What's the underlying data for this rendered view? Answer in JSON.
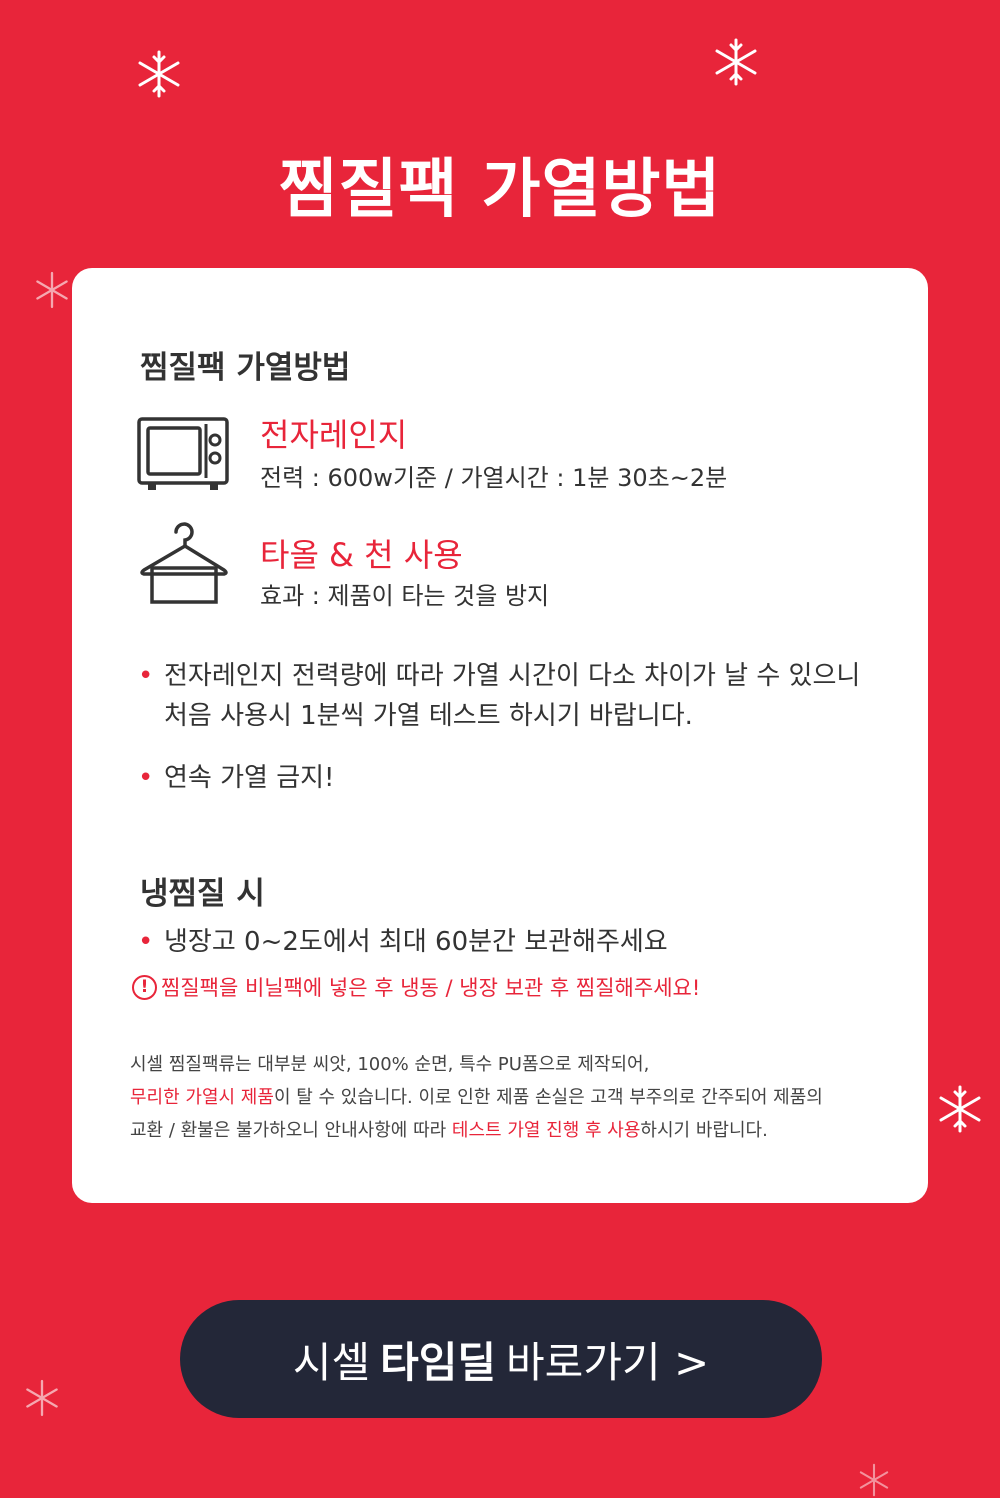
{
  "header": {
    "title": "찜질팩 가열방법"
  },
  "card": {
    "section_heat": {
      "title": "찜질팩 가열방법",
      "methods": [
        {
          "icon": "microwave-icon",
          "title": "전자레인지",
          "desc": "전력 : 600w기준 / 가열시간 : 1분 30초~2분"
        },
        {
          "icon": "towel-hanger-icon",
          "title": "타올 & 천 사용",
          "desc": "효과 : 제품이 타는 것을 방지"
        }
      ],
      "bullets": [
        {
          "line1": "전자레인지 전력량에 따라 가열 시간이 다소 차이가 날 수 있으니",
          "line2": "처음 사용시 1분씩 가열 테스트 하시기 바랍니다."
        },
        {
          "line1": "연속 가열 금지!"
        }
      ]
    },
    "section_cold": {
      "title": "냉찜질 시",
      "bullet": "냉장고 0~2도에서 최대 60분간 보관해주세요",
      "warning": "찜질팩을 비닐팩에 넣은 후 냉동 / 냉장 보관 후 찜질해주세요!"
    },
    "notice": {
      "line1": "시셀 찜질팩류는 대부분 씨앗, 100% 순면, 특수 PU폼으로 제작되어,",
      "line2_hl": "무리한 가열시 제품",
      "line2_rest": "이 탈 수 있습니다. 이로 인한 제품 손실은 고객 부주의로 간주되어  제품의",
      "line3_pre": "교환 / 환불은 불가하오니 안내사항에 따라 ",
      "line3_hl": "테스트 가열 진행 후 사용",
      "line3_post": "하시기 바랍니다."
    }
  },
  "cta": {
    "pre": "시셀",
    "bold": "타임딜",
    "post": "바로가기 >"
  },
  "colors": {
    "background": "#e8253a",
    "accent": "#e8253a",
    "button": "#232738"
  }
}
